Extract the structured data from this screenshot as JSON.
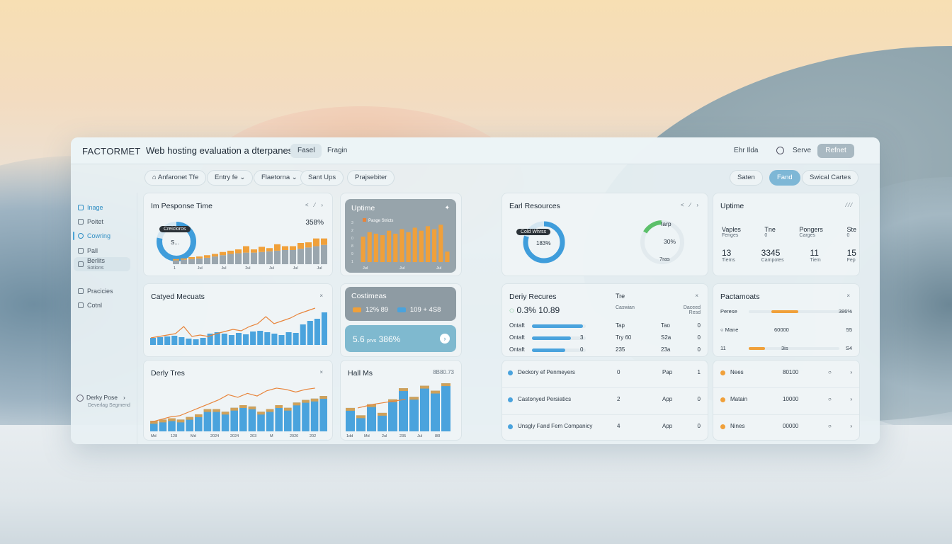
{
  "colors": {
    "accent_blue": "#4aa3dd",
    "accent_orange": "#f0a03a",
    "line_orange": "#e8843a",
    "bar_grey": "#9aa6ae",
    "card_dark": "#97a4ab",
    "upgrade_btn": "#a8b8c1",
    "active_chip": "#7eb7d6"
  },
  "topbar": {
    "brand": "FACTORMET",
    "doc_title": "Web hosting evaluation a dterpanes",
    "chip_1": "Fasel",
    "chip_2": "Fragin",
    "right_label": "Ehr Ilda",
    "share": "Serve",
    "upgrade": "Refnet"
  },
  "filters": {
    "f1": "Anfaronet Tfe",
    "f2": "Entry fe",
    "f3": "Flaetorna",
    "f4": "Sant Ups",
    "f5": "Prajsebiter",
    "r1": "Saten",
    "r2": "Fand",
    "r3": "Swical Cartes"
  },
  "sidebar": {
    "items": [
      {
        "label": "Inage",
        "icon": "image-icon"
      },
      {
        "label": "Poitet",
        "icon": "doc-icon"
      },
      {
        "label": "Cowring",
        "icon": "clock-icon"
      },
      {
        "label": "Pall",
        "icon": "folder-icon"
      },
      {
        "label": "Berlits",
        "sub": "Sotions",
        "icon": "chart-icon"
      },
      {
        "label": "Pracicies",
        "icon": "flag-icon"
      },
      {
        "label": "Cotnl",
        "icon": "gear-icon"
      }
    ],
    "profile_name": "Derky Pose",
    "profile_sub": "Deverlag Segmend"
  },
  "cards": {
    "response": {
      "title": "Im Pesponse Time",
      "ctrl": "< ⁄ ›",
      "donut_label": "Creicloros",
      "donut_center": "S...",
      "percent": "358%",
      "donut_fraction": 0.78,
      "ticks": [
        "1",
        "Jul",
        "Jul",
        "2ul",
        "Jul",
        "Jul",
        "Jul"
      ]
    },
    "uptime_dark": {
      "title": "Uptime",
      "legend": "Pasge Stricts",
      "ticks": [
        "Jul",
        "Jul",
        "Jul"
      ],
      "yticks": [
        "3",
        "2",
        "0",
        "8",
        "9",
        "1"
      ]
    },
    "cached": {
      "title": "Catyed Mecuats",
      "ctrl": "×"
    },
    "costimeas": {
      "title": "Costimeas",
      "c1": "12% 89",
      "c2": "109 + 4S8"
    },
    "teal": {
      "value": "5.6",
      "unit": "prvs",
      "value2": "386%"
    },
    "derly": {
      "title": "Derly Tres",
      "ctrl": "×",
      "ticks": [
        "Md",
        "128",
        "Md",
        "2024",
        "2024",
        "203",
        "M",
        "2020",
        "202"
      ]
    },
    "hall": {
      "title": "Hall Ms",
      "ctrl": "8B80.73",
      "ticks": [
        "1dd",
        "Md",
        "2ul",
        "235",
        "Jul",
        "80l"
      ]
    },
    "earl": {
      "title": "Earl Resources",
      "ctrl": "< ⁄ ›",
      "donut_label": "Cold Whrss",
      "donut_center": "183%",
      "donut_fraction": 0.8,
      "g_label": "Iarp",
      "g_center": "30%",
      "g_sub": "7ras",
      "g_fraction": 0.16
    },
    "uptime_stats": {
      "title": "Uptime",
      "ctrl": "⁄  ⁄  ⁄",
      "h": [
        {
          "t": "Vaples",
          "s": "Fenges"
        },
        {
          "t": "Tne",
          "s": "0"
        },
        {
          "t": "Pongers",
          "s": "Carges"
        },
        {
          "t": "Ste",
          "s": "0"
        }
      ],
      "v": [
        {
          "t": "13",
          "s": "Tiems"
        },
        {
          "t": "3345",
          "s": "Campotes"
        },
        {
          "t": "11",
          "s": "Tiem"
        },
        {
          "t": "15",
          "s": "Fep"
        }
      ]
    },
    "deriy": {
      "title": "Deriy Recures",
      "ctrl": "×",
      "head_a": "Tre",
      "head_b": "Caswian",
      "head_c": "Daceed Resd",
      "big": "0.3% 10.89",
      "rows": [
        {
          "l": "Ontaft",
          "a": "Tap",
          "b": "Tao",
          "c": "0",
          "fill": 0.95,
          "n": ""
        },
        {
          "l": "Ontaft",
          "a": "Try 60",
          "b": "S2a",
          "c": "0",
          "fill": 0.72,
          "n": "3"
        },
        {
          "l": "Ontaft",
          "a": "235",
          "b": "23a",
          "c": "0",
          "fill": 0.62,
          "n": "0"
        }
      ]
    },
    "pactamats": {
      "title": "Pactamoats",
      "ctrl": "×",
      "rows": [
        {
          "l": "Perese",
          "v": "",
          "n": "386%",
          "fill_from": 0.25,
          "fill_to": 0.55
        },
        {
          "l": "Mane",
          "v": "60000",
          "n": "55",
          "fill_from": 0,
          "fill_to": 0
        },
        {
          "l": "11",
          "v": "3is",
          "n": "S4",
          "fill_from": 0,
          "fill_to": 0.18
        }
      ]
    },
    "list_left": {
      "rows": [
        {
          "l": "Deckory ef Penmeyers",
          "a": "0",
          "b": "Pap",
          "c": "1"
        },
        {
          "l": "Castonyed Persiatics",
          "a": "2",
          "b": "App",
          "c": "0"
        },
        {
          "l": "Unsgly Fand Fem Companicy",
          "a": "4",
          "b": "App",
          "c": "0"
        }
      ]
    },
    "list_right": {
      "rows": [
        {
          "l": "Nees",
          "v": "80100"
        },
        {
          "l": "Matain",
          "v": "10000"
        },
        {
          "l": "Nines",
          "v": "00000"
        }
      ]
    }
  },
  "chart_data": [
    {
      "type": "bar",
      "title": "Im Pesponse Time",
      "series": [
        {
          "values": [
            6,
            7,
            8,
            9,
            10,
            12,
            14,
            16,
            17,
            18,
            18,
            19,
            20,
            21,
            22,
            22,
            24,
            26,
            28,
            30
          ]
        },
        {
          "values": [
            2,
            2,
            3,
            3,
            4,
            4,
            5,
            5,
            6,
            10,
            5,
            8,
            5,
            10,
            6,
            6,
            9,
            8,
            12,
            10
          ]
        }
      ],
      "ylim": [
        0,
        55
      ]
    },
    {
      "type": "bar",
      "title": "Uptime",
      "values": [
        34,
        40,
        38,
        36,
        42,
        38,
        44,
        40,
        46,
        42,
        48,
        44,
        50,
        14
      ],
      "ylim": [
        0,
        55
      ]
    },
    {
      "type": "bar",
      "title": "Catyed Mecuats",
      "values": [
        10,
        11,
        12,
        13,
        11,
        9,
        8,
        10,
        16,
        18,
        16,
        14,
        17,
        15,
        19,
        20,
        18,
        16,
        14,
        18,
        17,
        29,
        34,
        37,
        46
      ],
      "line": [
        10,
        12,
        14,
        16,
        26,
        12,
        14,
        12,
        16,
        19,
        22,
        20,
        26,
        30,
        40,
        30,
        34,
        38,
        44,
        48,
        52
      ],
      "ylim": [
        0,
        60
      ]
    },
    {
      "type": "bar",
      "title": "Derly Tres",
      "values": [
        16,
        18,
        20,
        18,
        22,
        26,
        34,
        34,
        30,
        36,
        40,
        38,
        30,
        34,
        40,
        36,
        44,
        48,
        50,
        54
      ],
      "line": [
        14,
        18,
        22,
        24,
        30,
        36,
        42,
        48,
        56,
        52,
        58,
        54,
        62,
        66,
        64,
        60,
        64,
        66
      ],
      "ylim": [
        0,
        80
      ]
    },
    {
      "type": "bar",
      "title": "Hall Ms",
      "values": [
        38,
        26,
        44,
        30,
        52,
        70,
        56,
        74,
        66,
        78
      ],
      "line": [
        38,
        44,
        48,
        52
      ],
      "ylim": [
        0,
        85
      ]
    }
  ]
}
